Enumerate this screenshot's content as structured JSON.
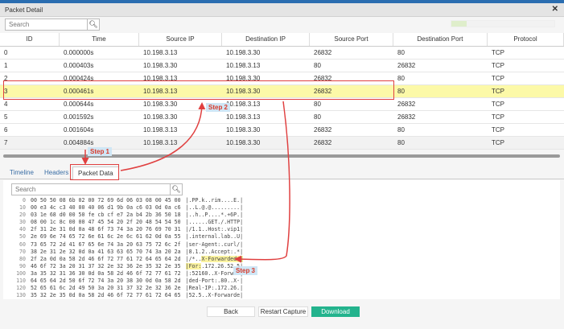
{
  "window": {
    "title": "Packet Detail",
    "close_icon": "close-icon"
  },
  "top_search": {
    "placeholder": "Search",
    "icon": "search-icon"
  },
  "progress": {
    "fraction": 0.15,
    "color": "#dfeecb"
  },
  "table": {
    "columns": [
      "ID",
      "Time",
      "Source IP",
      "Destination IP",
      "Source Port",
      "Destination Port",
      "Protocol"
    ],
    "rows": [
      [
        "0",
        "0.000000s",
        "10.198.3.13",
        "10.198.3.30",
        "26832",
        "80",
        "TCP"
      ],
      [
        "1",
        "0.000403s",
        "10.198.3.30",
        "10.198.3.13",
        "80",
        "26832",
        "TCP"
      ],
      [
        "2",
        "0.000424s",
        "10.198.3.13",
        "10.198.3.30",
        "26832",
        "80",
        "TCP"
      ],
      [
        "3",
        "0.000461s",
        "10.198.3.13",
        "10.198.3.30",
        "26832",
        "80",
        "TCP"
      ],
      [
        "4",
        "0.000644s",
        "10.198.3.30",
        "10.198.3.13",
        "80",
        "26832",
        "TCP"
      ],
      [
        "5",
        "0.001592s",
        "10.198.3.30",
        "10.198.3.13",
        "80",
        "26832",
        "TCP"
      ],
      [
        "6",
        "0.001604s",
        "10.198.3.13",
        "10.198.3.30",
        "26832",
        "80",
        "TCP"
      ],
      [
        "7",
        "0.004884s",
        "10.198.3.13",
        "10.198.3.30",
        "26832",
        "80",
        "TCP"
      ]
    ],
    "selected_row": 3,
    "selected_color": "#fcf9a8"
  },
  "tabs": [
    {
      "label": "Timeline"
    },
    {
      "label": "Headers"
    },
    {
      "label": "Packet Data",
      "active": true
    }
  ],
  "packet_search": {
    "placeholder": "Search"
  },
  "hex": [
    {
      "offset": "0",
      "bytes": "00 50 50 08 6b 02 00 72 69 6d 06 03 08 00 45 00",
      "pre": "|.PP.k..rim....E.|",
      "hl": "",
      "post": ""
    },
    {
      "offset": "10",
      "bytes": "00 e3 4c c3 40 00 40 06 d1 9b 0a c6 03 0d 0a c6",
      "pre": "|..L.@.@.........|",
      "hl": "",
      "post": ""
    },
    {
      "offset": "20",
      "bytes": "03 1e 68 d0 00 50 fe cb cf e7 2a b4 2b 36 50 18",
      "pre": "|..h..P....*.+6P.|",
      "hl": "",
      "post": ""
    },
    {
      "offset": "30",
      "bytes": "08 00 1c 8c 00 00 47 45 54 20 2f 20 48 54 54 50",
      "pre": "|......GET./.HTTP|",
      "hl": "",
      "post": ""
    },
    {
      "offset": "40",
      "bytes": "2f 31 2e 31 0d 0a 48 6f 73 74 3a 20 76 69 70 31",
      "pre": "|/1.1..Host:.vip1|",
      "hl": "",
      "post": ""
    },
    {
      "offset": "50",
      "bytes": "2e 69 6e 74 65 72 6e 61 6c 2e 6c 61 62 0d 0a 55",
      "pre": "|.internal.lab..U|",
      "hl": "",
      "post": ""
    },
    {
      "offset": "60",
      "bytes": "73 65 72 2d 41 67 65 6e 74 3a 20 63 75 72 6c 2f",
      "pre": "|ser-Agent:.curl/|",
      "hl": "",
      "post": ""
    },
    {
      "offset": "70",
      "bytes": "38 2e 31 2e 32 0d 0a 41 63 63 65 70 74 3a 20 2a",
      "pre": "|8.1.2..Accept:.*|",
      "hl": "",
      "post": ""
    },
    {
      "offset": "80",
      "bytes": "2f 2a 0d 0a 58 2d 46 6f 72 77 61 72 64 65 64 2d",
      "pre": "|/*..",
      "hl": "X-Forwarded-|",
      "post": ""
    },
    {
      "offset": "90",
      "bytes": "46 6f 72 3a 20 31 37 32 2e 32 36 2e 35 32 2e 35",
      "pre": "",
      "hl": "|For:",
      "post": ".172.26.52.5|"
    },
    {
      "offset": "100",
      "bytes": "3a 35 32 31 36 30 0d 0a 58 2d 46 6f 72 77 61 72",
      "pre": "|:52160..X-Forwar|",
      "hl": "",
      "post": ""
    },
    {
      "offset": "110",
      "bytes": "64 65 64 2d 50 6f 72 74 3a 20 38 30 0d 0a 58 2d",
      "pre": "|ded-Port:.80..X-|",
      "hl": "",
      "post": ""
    },
    {
      "offset": "120",
      "bytes": "52 65 61 6c 2d 49 50 3a 20 31 37 32 2e 32 36 2e",
      "pre": "|Real-IP:.172.26.|",
      "hl": "",
      "post": ""
    },
    {
      "offset": "130",
      "bytes": "35 32 2e 35 0d 0a 58 2d 46 6f 72 77 61 72 64 65",
      "pre": "|52.5..X-Forwarde|",
      "hl": "",
      "post": ""
    }
  ],
  "buttons": {
    "back": "Back",
    "restart": "Restart Capture",
    "download": "Download",
    "download_color": "#23b38d"
  },
  "annotations": {
    "step1": "Step 1",
    "step2": "Step 2",
    "step3": "Step 3",
    "color": "#e04040"
  }
}
